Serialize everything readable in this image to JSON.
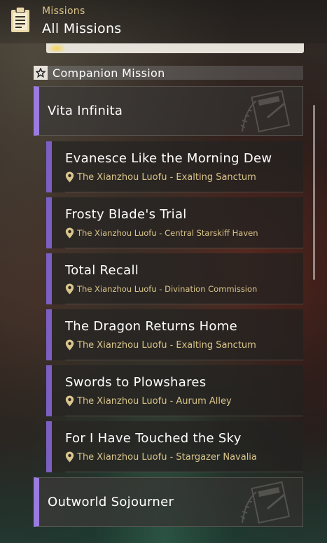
{
  "header": {
    "subtitle": "Missions",
    "title": "All Missions",
    "icon": "clipboard-icon"
  },
  "section": {
    "label": "Companion Mission",
    "icon": "star-icon"
  },
  "groups": [
    {
      "title": "Vita Infinita",
      "missions": [
        {
          "title": "Evanesce Like the Morning Dew",
          "location": "The Xianzhou Luofu - Exalting Sanctum"
        },
        {
          "title": "Frosty Blade's Trial",
          "location": "The Xianzhou Luofu - Central Starskiff Haven"
        },
        {
          "title": "Total Recall",
          "location": "The Xianzhou Luofu - Divination Commission"
        },
        {
          "title": "The Dragon Returns Home",
          "location": "The Xianzhou Luofu - Exalting Sanctum"
        },
        {
          "title": "Swords to Plowshares",
          "location": "The Xianzhou Luofu - Aurum Alley"
        },
        {
          "title": "For I Have Touched the Sky",
          "location": "The Xianzhou Luofu - Stargazer Navalia"
        }
      ]
    },
    {
      "title": "Outworld Sojourner",
      "missions": []
    }
  ],
  "colors": {
    "accent_purple": "#9b7be0",
    "location_gold": "#d9c48a"
  }
}
